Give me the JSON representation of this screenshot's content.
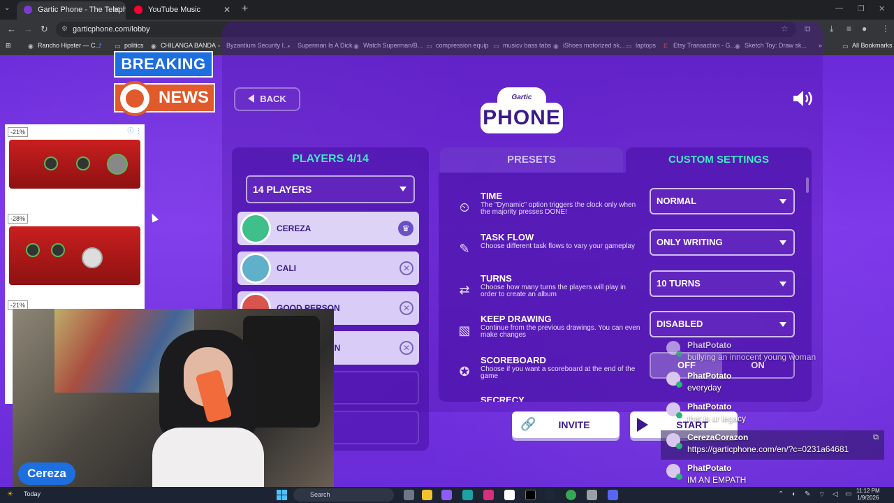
{
  "browser": {
    "tabs": [
      {
        "title": "Gartic Phone - The Telephone G",
        "favicon_color": "#7b3ad6"
      },
      {
        "title": "YouTube Music",
        "favicon_color": "#ff0033"
      }
    ],
    "url": "garticphone.com/lobby",
    "bookmarks": [
      "Rancho Hipster — C...",
      "politics",
      "CHILANGA BANDA",
      "Byzantium Security I...",
      "Superman Is A Dick",
      "Watch Superman/B...",
      "compression equip",
      "musicv bass tabs",
      "iShoes motorized sk...",
      "laptops",
      "Etsy Transaction - G...",
      "Sketch Toy: Draw sk..."
    ],
    "all_bookmarks": "All Bookmarks"
  },
  "overlay": {
    "breaking": "BREAKING",
    "news": "NEWS",
    "streamer_name": "Cereza"
  },
  "ad": {
    "items": [
      {
        "badge": "-21%"
      },
      {
        "badge": "-28%"
      },
      {
        "badge": "-21%"
      }
    ]
  },
  "game": {
    "back_label": "BACK",
    "logo_top": "Gartic",
    "logo_main": "PHONE",
    "players_title": "PLAYERS 4/14",
    "players_select": "14 PLAYERS",
    "players": [
      {
        "name": "CEREZA",
        "role": "host",
        "avatar_color": "#3fbf8a"
      },
      {
        "name": "CALI",
        "role": "player",
        "avatar_color": "#5fb0c9"
      },
      {
        "name": "GOOD PERSON",
        "role": "player",
        "avatar_color": "#d9534f"
      },
      {
        "name": "AN",
        "role": "player",
        "avatar_color": "#8d6bc9"
      }
    ],
    "tab_presets": "PRESETS",
    "tab_custom": "CUSTOM SETTINGS",
    "settings": [
      {
        "title": "TIME",
        "desc": "The \"Dynamic\" option triggers the clock only when the majority presses DONE!",
        "value": "NORMAL",
        "icon": "clock-icon"
      },
      {
        "title": "TASK FLOW",
        "desc": "Choose different task flows to vary your gameplay",
        "value": "ONLY WRITING",
        "icon": "pen-speech-icon"
      },
      {
        "title": "TURNS",
        "desc": "Choose how many turns the players will play in order to create an album",
        "value": "10 TURNS",
        "icon": "arrows-icon"
      },
      {
        "title": "KEEP DRAWING",
        "desc": "Continue from the previous drawings. You can even make changes",
        "value": "DISABLED",
        "icon": "picture-icon"
      },
      {
        "title": "SCOREBOARD",
        "desc": "Choose if you want a scoreboard at the end of the game",
        "off": "OFF",
        "on": "ON",
        "icon": "medal-icon"
      },
      {
        "title": "SECRECY",
        "desc": "",
        "value": "",
        "icon": "eye-icon"
      }
    ],
    "invite_label": "INVITE",
    "start_label": "START"
  },
  "chat": [
    {
      "user": "PhatPotato",
      "text": "bullying an innocent young woman"
    },
    {
      "user": "PhatPotato",
      "text": "everyday"
    },
    {
      "user": "PhatPotato",
      "text": "that is ur legacy"
    },
    {
      "user": "CerezaCorazon",
      "text": "https://garticphone.com/en/?c=0231a64681"
    },
    {
      "user": "PhatPotato",
      "text": "IM AN EMPATH"
    }
  ],
  "taskbar": {
    "weather": "Today",
    "search": "Search",
    "time": "11:12 PM",
    "date": "1/9/2026"
  }
}
